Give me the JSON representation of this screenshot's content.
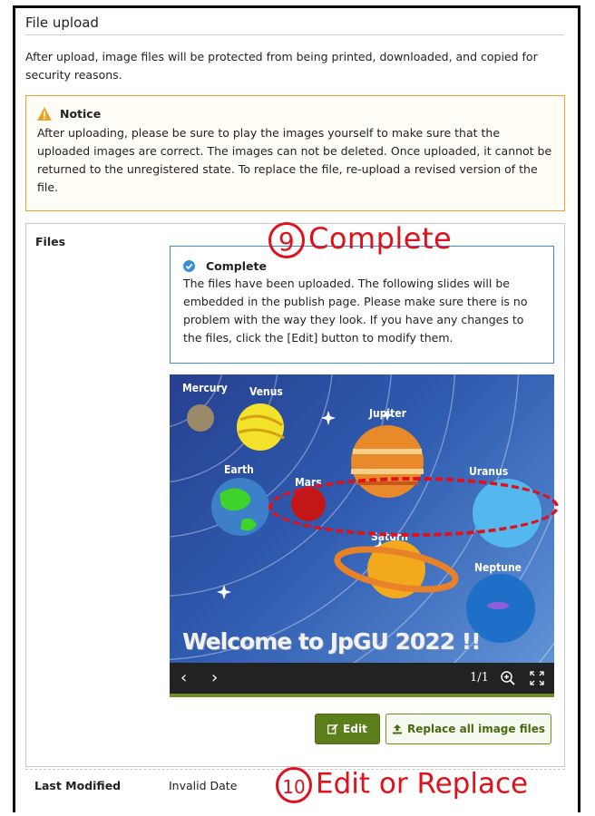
{
  "section": {
    "title": "File upload",
    "intro": "After upload, image files will be protected from being printed, downloaded, and copied for security reasons."
  },
  "notice": {
    "icon": "warning-icon",
    "title": "Notice",
    "body": "After uploading, please be sure to play the images yourself to make sure that the uploaded images are correct. The images can not be deleted. Once uploaded, it cannot be returned to the unregistered state. To replace the file, re-upload a revised version of the file."
  },
  "files": {
    "label": "Files",
    "complete": {
      "icon": "check-circle-icon",
      "title": "Complete",
      "body": "The files have been uploaded. The following slides will be embedded in the publish page. Please make sure there is no problem with the way they look. If you have any changes to the files, click the [Edit] button to modify them."
    },
    "slide": {
      "planets": [
        "Mercury",
        "Venus",
        "Jupiter",
        "Earth",
        "Mars",
        "Uranus",
        "Saturn",
        "Neptune"
      ],
      "caption": "Welcome to JpGU 2022 !!",
      "page_counter": "1/1"
    },
    "buttons": {
      "edit": "Edit",
      "replace": "Replace all image files"
    }
  },
  "last_modified": {
    "label": "Last Modified",
    "value": "Invalid Date"
  },
  "annotations": {
    "step9_num": "9",
    "step9_text": "Complete",
    "step10_num": "10",
    "step10_text": "Edit or Replace"
  },
  "colors": {
    "annotation_red": "#e0101c",
    "notice_border": "#e6a52a",
    "complete_border": "#3a8ed6",
    "button_green": "#5b7e1b"
  }
}
